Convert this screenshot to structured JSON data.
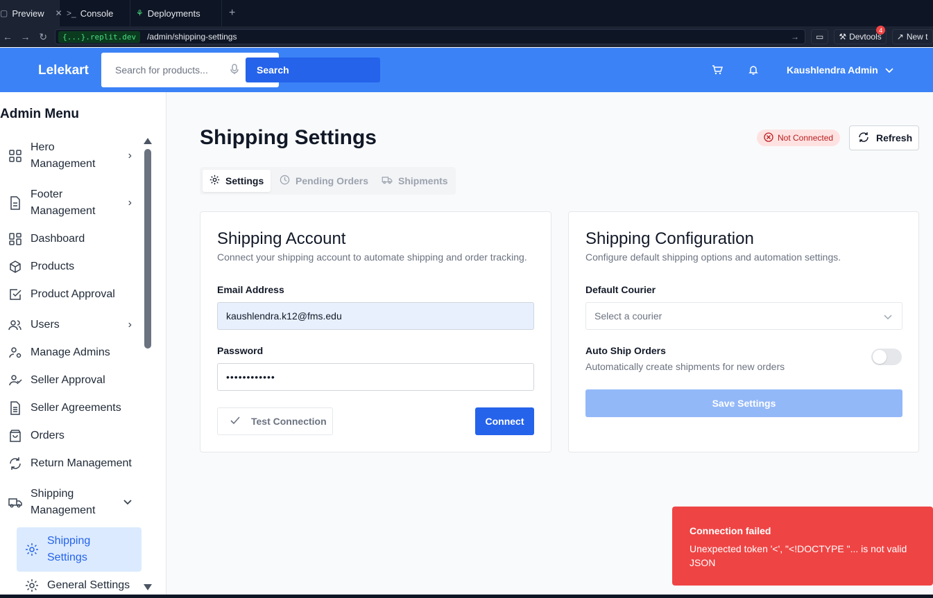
{
  "browser": {
    "tabs": [
      {
        "label": "Preview",
        "icon": "preview-icon"
      },
      {
        "label": "Console",
        "icon": "terminal-icon"
      },
      {
        "label": "Deployments",
        "icon": "deploy-icon"
      }
    ],
    "domain": "{...}.replit.dev",
    "path": "/admin/shipping-settings",
    "devtools_label": "Devtools",
    "devtools_badge": "4",
    "new_tab_label": "New t"
  },
  "header": {
    "logo": "Lelekart",
    "search_placeholder": "Search for products...",
    "search_button": "Search",
    "user_name": "Kaushlendra Admin",
    "bg_color": "#3b82f6"
  },
  "sidebar": {
    "title": "Admin Menu",
    "items": [
      {
        "label": "Hero Management",
        "line1": "Hero",
        "line2": "Management",
        "icon": "grid-icon",
        "has_chevron": true
      },
      {
        "label": "Footer Management",
        "line1": "Footer",
        "line2": "Management",
        "icon": "file-icon",
        "has_chevron": true
      },
      {
        "label": "Dashboard",
        "icon": "dashboard-icon"
      },
      {
        "label": "Products",
        "icon": "box-icon"
      },
      {
        "label": "Product Approval",
        "icon": "check-square-icon"
      },
      {
        "label": "Users",
        "icon": "users-icon",
        "has_chevron": true
      },
      {
        "label": "Manage Admins",
        "icon": "user-cog-icon"
      },
      {
        "label": "Seller Approval",
        "icon": "user-check-icon"
      },
      {
        "label": "Seller Agreements",
        "icon": "file-text-icon"
      },
      {
        "label": "Orders",
        "icon": "shopping-bag-icon"
      },
      {
        "label": "Return Management",
        "icon": "refresh-icon"
      },
      {
        "label": "Shipping Management",
        "line1": "Shipping",
        "line2": "Management",
        "icon": "truck-icon",
        "expanded": true
      },
      {
        "label": "Shipping Settings",
        "line1": "Shipping",
        "line2": "Settings",
        "icon": "gear-icon",
        "active": true
      },
      {
        "label": "General Settings",
        "icon": "gear-icon"
      }
    ]
  },
  "main": {
    "title": "Shipping Settings",
    "status": "Not Connected",
    "refresh_label": "Refresh",
    "tabs": [
      {
        "label": "Settings",
        "active": true
      },
      {
        "label": "Pending Orders"
      },
      {
        "label": "Shipments"
      }
    ],
    "account_card": {
      "title": "Shipping Account",
      "subtitle": "Connect your shipping account to automate shipping and order tracking.",
      "email_label": "Email Address",
      "email_value": "kaushlendra.k12@fms.edu",
      "password_label": "Password",
      "password_value": "••••••••••••",
      "test_button": "Test Connection",
      "connect_button": "Connect"
    },
    "config_card": {
      "title": "Shipping Configuration",
      "subtitle": "Configure default shipping options and automation settings.",
      "courier_label": "Default Courier",
      "courier_placeholder": "Select a courier",
      "auto_ship_label": "Auto Ship Orders",
      "auto_ship_desc": "Automatically create shipments for new orders",
      "auto_ship_on": false,
      "save_button": "Save Settings"
    }
  },
  "toast": {
    "title": "Connection failed",
    "message": "Unexpected token '<', \"<!DOCTYPE \"... is not valid JSON",
    "color": "#ef4444"
  }
}
